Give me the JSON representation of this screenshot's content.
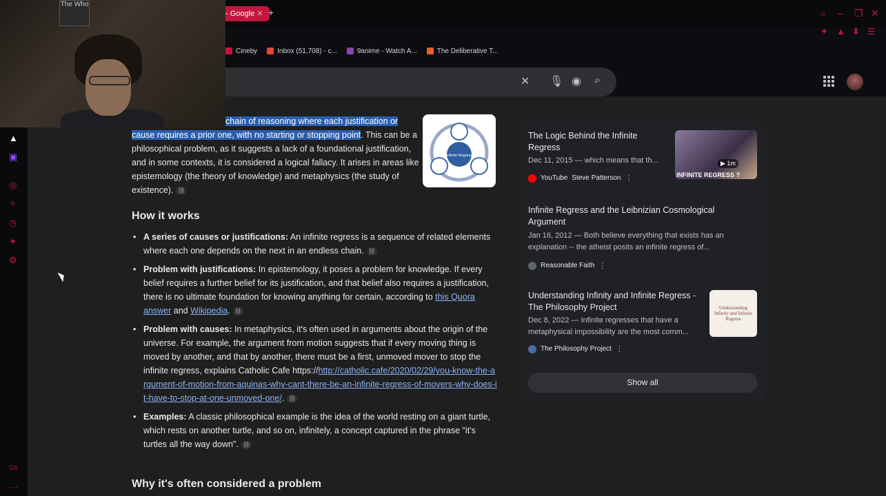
{
  "browser": {
    "tab_title": "- Google",
    "new_tab": "+",
    "bookmarks": [
      {
        "label": "Cineby",
        "color": "#c2173c"
      },
      {
        "label": "Inbox (51,708) - c...",
        "color": "#ea4335"
      },
      {
        "label": "9anime - Watch A...",
        "color": "#8e44ad"
      },
      {
        "label": "The Deliberative T...",
        "color": "#e8622a"
      }
    ],
    "accent_color": "#c2173c"
  },
  "search": {
    "icons": [
      "close-icon",
      "mic-icon",
      "lens-icon",
      "search-icon"
    ]
  },
  "overview": {
    "intro_hl1": "chain of reasoning where each justification or",
    "intro_hl2": "cause requires a prior one, with no starting or stopping point",
    "intro_rest": ". This can be a philosophical problem, as it suggests a lack of a foundational justification, and in some contexts, it is considered a logical fallacy. It arises in areas like epistemology (the theory of knowledge) and metaphysics (the study of existence).",
    "heading_how": "How it works",
    "bullets": [
      {
        "bold": "A series of causes or justifications:",
        "text": " An infinite regress is a sequence of related elements where each one depends on the next in an endless chain."
      },
      {
        "bold": "Problem with justifications:",
        "text": " In epistemology, it poses a problem for knowledge. If every belief requires a further belief for its justification, and that belief also requires a justification, there is no ultimate foundation for knowing anything for certain, according to ",
        "link1": "this Quora answer",
        "mid": " and ",
        "link2": "Wikipedia",
        "end": "."
      },
      {
        "bold": "Problem with causes:",
        "text": " In metaphysics, it's often used in arguments about the origin of the universe. For example, the argument from motion suggests that if every moving thing is moved by another, and that by another, there must be a first, unmoved mover to stop the infinite regress, explains Catholic Cafe https://",
        "link1": "http://catholic.cafe/2020/02/29/you-know-the-argument-of-motion-from-aquinas-why-cant-there-be-an-infinite-regress-of-movers-why-does-it-have-to-stop-at-one-unmoved-one/",
        "end": "."
      },
      {
        "bold": "Examples:",
        "text": " A classic philosophical example is the idea of the world resting on a giant turtle, which rests on another turtle, and so on, infinitely, a concept captured in the phrase \"it's turtles all the way down\"."
      }
    ],
    "heading_why": "Why it's often considered a problem",
    "diagram_label": "Infinite Regress"
  },
  "results": [
    {
      "title": "The Logic Behind the Infinite Regress",
      "snippet": "Dec 11, 2015 — which means that th...",
      "source": "YouTube",
      "author": "Steve Patterson",
      "thumb_caption": "INFINITE REGRESS ?",
      "duration": "1m"
    },
    {
      "title": "Infinite Regress and the Leibnizian Cosmological Argument",
      "snippet": "Jan 16, 2012 — Both believe everything that exists has an explanation -- the atheist posits an infinite regress of...",
      "source": "Reasonable Faith"
    },
    {
      "title": "Understanding Infinity and Infinite Regress - The Philosophy Project",
      "snippet": "Dec 8, 2022 — Infinite regresses that have a metaphysical impossibility are the most comm...",
      "source": "The Philosophy Project",
      "thumb_caption": "Understanding Infinity and Infinite Regress"
    }
  ],
  "show_all": "Show all",
  "webcam": {
    "poster_text": "The Who"
  }
}
